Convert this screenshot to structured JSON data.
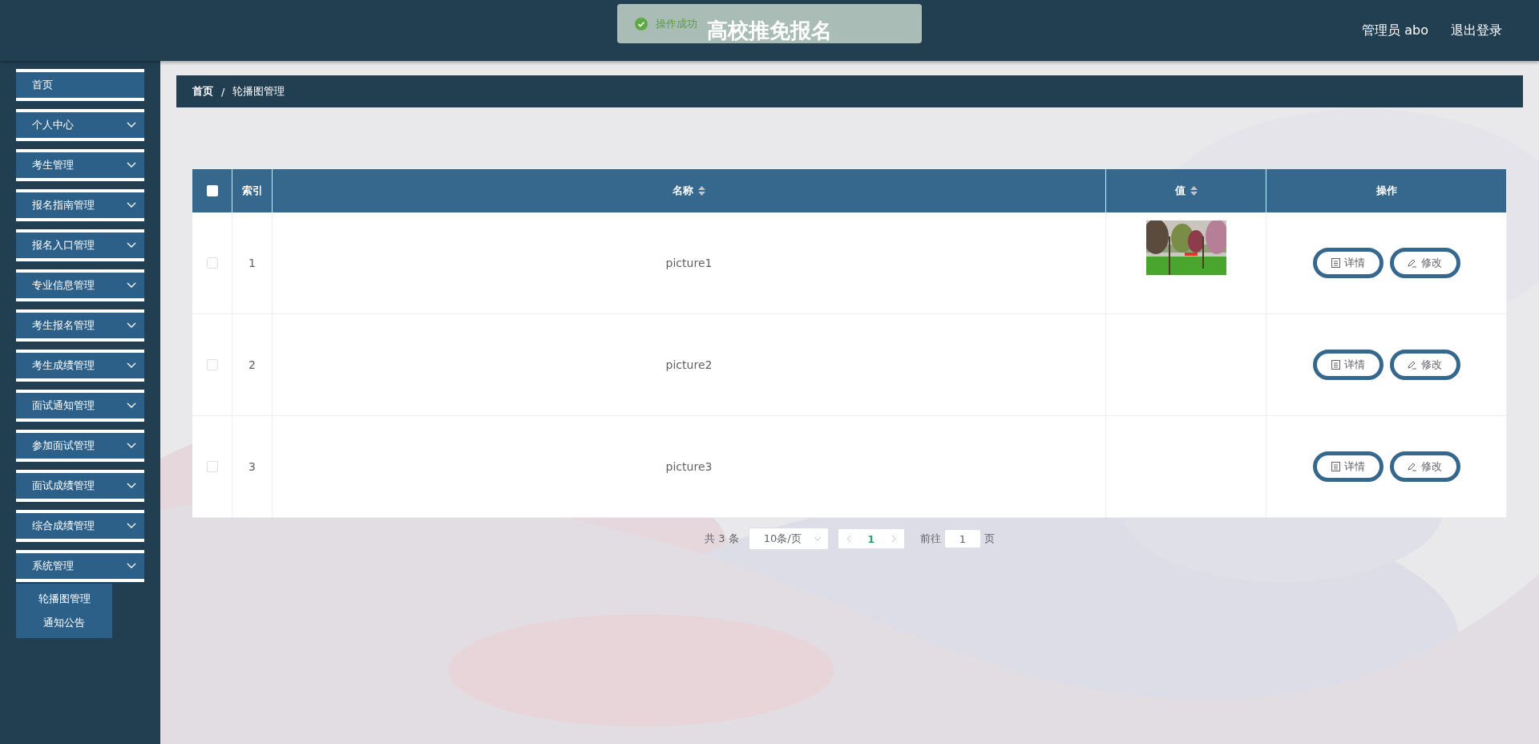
{
  "header": {
    "title": "高校推免报名",
    "user": "管理员 abo",
    "logout": "退出登录"
  },
  "toast": {
    "kind": "success",
    "message": "操作成功"
  },
  "sidebar": {
    "items": [
      {
        "label": "首页",
        "kind": "link"
      },
      {
        "label": "个人中心",
        "kind": "submenu"
      },
      {
        "label": "考生管理",
        "kind": "submenu"
      },
      {
        "label": "报名指南管理",
        "kind": "submenu"
      },
      {
        "label": "报名入口管理",
        "kind": "submenu"
      },
      {
        "label": "专业信息管理",
        "kind": "submenu"
      },
      {
        "label": "考生报名管理",
        "kind": "submenu"
      },
      {
        "label": "考生成绩管理",
        "kind": "submenu"
      },
      {
        "label": "面试通知管理",
        "kind": "submenu"
      },
      {
        "label": "参加面试管理",
        "kind": "submenu"
      },
      {
        "label": "面试成绩管理",
        "kind": "submenu"
      },
      {
        "label": "综合成绩管理",
        "kind": "submenu"
      },
      {
        "label": "系统管理",
        "kind": "submenu",
        "children": [
          {
            "label": "轮播图管理"
          },
          {
            "label": "通知公告"
          }
        ]
      }
    ]
  },
  "breadcrumb": {
    "separator": "/",
    "items": [
      "首页",
      "轮播图管理"
    ]
  },
  "table": {
    "select_all": {
      "checked": false
    },
    "columns": [
      {
        "label": "索引",
        "sortable": false
      },
      {
        "label": "名称",
        "sortable": true
      },
      {
        "label": "值",
        "sortable": true
      },
      {
        "label": "操作",
        "sortable": false
      }
    ],
    "rows": [
      {
        "checked": false,
        "index": "1",
        "name": "picture1",
        "value": {
          "kind": "picture"
        },
        "actions": [
          "详情",
          "修改"
        ]
      },
      {
        "checked": false,
        "index": "2",
        "name": "picture2",
        "actions": [
          "详情",
          "修改"
        ]
      },
      {
        "checked": false,
        "index": "3",
        "name": "picture3",
        "actions": [
          "详情",
          "修改"
        ]
      }
    ]
  },
  "pagination": {
    "total": "共 3 条",
    "page_size": "10条/页",
    "pages": [
      {
        "label": "1",
        "selected": true
      }
    ],
    "goto_label": "前往",
    "goto_value": "1",
    "page_unit": "页"
  }
}
